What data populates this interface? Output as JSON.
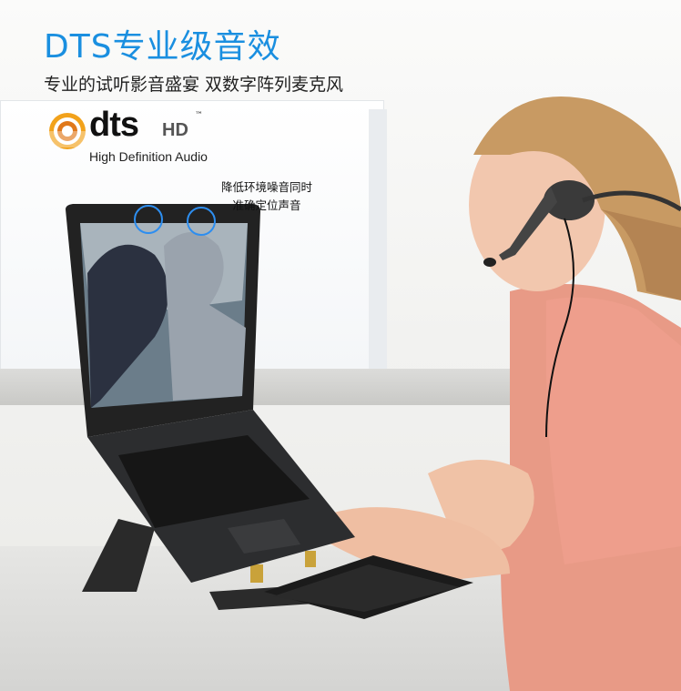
{
  "header": {
    "title": "DTS专业级音效",
    "subtitle": "专业的试听影音盛宴  双数字阵列麦克风"
  },
  "logo": {
    "wordmark_dts": "dts",
    "wordmark_hd": "HD",
    "trademark": "™",
    "caption": "High Definition Audio"
  },
  "annotation": {
    "line1": "降低环境噪音同时",
    "line2": "准确定位声音"
  },
  "colors": {
    "accent": "#1a8fe0",
    "mic_ring": "#2d8ef0"
  }
}
